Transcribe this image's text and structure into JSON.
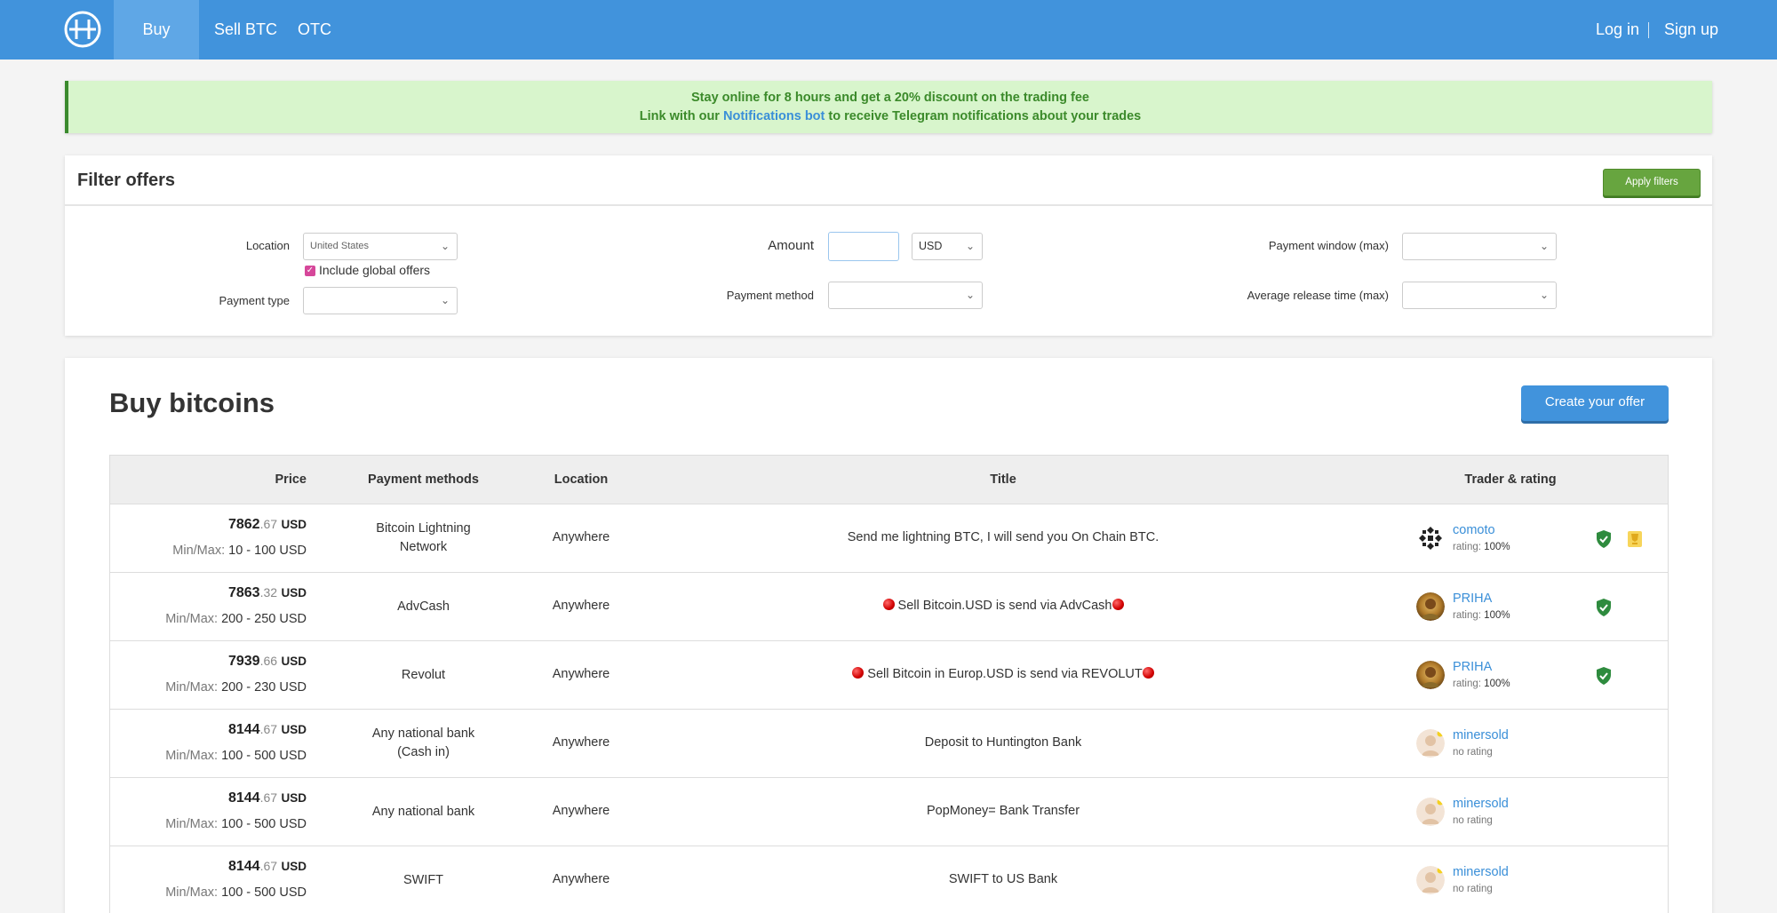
{
  "nav": {
    "tabs": [
      "Buy BTC",
      "Sell BTC",
      "OTC"
    ],
    "active_tab": "Buy BTC",
    "login": "Log in",
    "signup": "Sign up",
    "logo_icon": "h-coin-logo-icon"
  },
  "banner": {
    "line1": "Stay online for 8 hours and get a 20% discount on the trading fee",
    "line2_prefix": "Link with our ",
    "line2_link": "Notifications bot",
    "line2_suffix": " to receive Telegram notifications about your trades"
  },
  "filter": {
    "title": "Filter offers",
    "apply_label": "Apply filters",
    "location_label": "Location",
    "location_value": "United States",
    "include_global_label": "Include global offers",
    "include_global_checked": true,
    "payment_type_label": "Payment type",
    "payment_type_value": "",
    "amount_label": "Amount",
    "amount_value": "",
    "currency_value": "USD",
    "payment_method_label": "Payment method",
    "payment_method_value": "",
    "payment_window_label": "Payment window (max)",
    "payment_window_value": "",
    "release_time_label": "Average release time (max)",
    "release_time_value": ""
  },
  "main": {
    "title": "Buy bitcoins",
    "create_label": "Create your offer",
    "columns": {
      "price": "Price",
      "payment_methods": "Payment methods",
      "location": "Location",
      "title": "Title",
      "trader": "Trader & rating"
    },
    "minmax_label": "Min/Max:",
    "currency": "USD",
    "rows": [
      {
        "price_int": "7862",
        "price_dec": ".67",
        "minmax": "10 - 100 USD",
        "payment_line1": "Bitcoin Lightning",
        "payment_line2": "Network",
        "location": "Anywhere",
        "title": "Send me lightning BTC, I will send you On Chain BTC.",
        "trader": "comoto",
        "rating_label": "rating:",
        "rating_value": "100%",
        "verified": true,
        "badge": true
      },
      {
        "price_int": "7863",
        "price_dec": ".32",
        "minmax": "200 - 250 USD",
        "payment_line1": "AdvCash",
        "payment_line2": "",
        "location": "Anywhere",
        "title_prefix_icon": "red-circle",
        "title": " Sell Bitcoin.USD is send via AdvCash",
        "title_suffix_icon": "red-circle",
        "trader": "PRIHA",
        "rating_label": "rating:",
        "rating_value": "100%",
        "verified": true,
        "badge": false
      },
      {
        "price_int": "7939",
        "price_dec": ".66",
        "minmax": "200 - 230 USD",
        "payment_line1": "Revolut",
        "payment_line2": "",
        "location": "Anywhere",
        "title_prefix_icon": "red-circle",
        "title": " Sell Bitcoin in Europ.USD is send via REVOLUT",
        "title_suffix_icon": "red-circle",
        "trader": "PRIHA",
        "rating_label": "rating:",
        "rating_value": "100%",
        "verified": true,
        "badge": false
      },
      {
        "price_int": "8144",
        "price_dec": ".67",
        "minmax": "100 - 500 USD",
        "payment_line1": "Any national bank",
        "payment_line2": "(Cash in)",
        "location": "Anywhere",
        "title": "Deposit to Huntington Bank",
        "trader": "minersold",
        "rating_label": "no rating",
        "rating_value": "",
        "verified": false,
        "badge": false
      },
      {
        "price_int": "8144",
        "price_dec": ".67",
        "minmax": "100 - 500 USD",
        "payment_line1": "Any national bank",
        "payment_line2": "",
        "location": "Anywhere",
        "title": "PopMoney= Bank Transfer",
        "trader": "minersold",
        "rating_label": "no rating",
        "rating_value": "",
        "verified": false,
        "badge": false
      },
      {
        "price_int": "8144",
        "price_dec": ".67",
        "minmax": "100 - 500 USD",
        "payment_line1": "SWIFT",
        "payment_line2": "",
        "location": "Anywhere",
        "title": "SWIFT to US Bank",
        "trader": "minersold",
        "rating_label": "no rating",
        "rating_value": "",
        "verified": false,
        "badge": false
      }
    ]
  },
  "colors": {
    "brand": "#4193dc",
    "apply_green": "#67a53f",
    "banner_bg": "#d8f5cc",
    "banner_text": "#3b8a2a",
    "link": "#3a8fd8",
    "verified": "#2e8b3e"
  }
}
